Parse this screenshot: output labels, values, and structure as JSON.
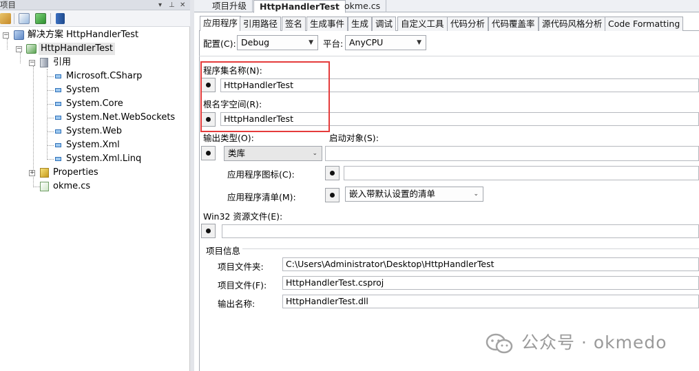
{
  "explorer": {
    "title": "项目",
    "title_controls": [
      "▾",
      "⊥",
      "✕"
    ],
    "tree": {
      "solution": "解决方案 HttpHandlerTest",
      "project": "HttpHandlerTest",
      "references_label": "引用",
      "references": [
        "Microsoft.CSharp",
        "System",
        "System.Core",
        "System.Net.WebSockets",
        "System.Web",
        "System.Xml",
        "System.Xml.Linq"
      ],
      "properties": "Properties",
      "file": "okme.cs"
    }
  },
  "doc_tabs": [
    "项目升级",
    "HttpHandlerTest",
    "okme.cs"
  ],
  "prop_tabs": [
    "应用程序",
    "引用路径",
    "签名",
    "生成事件",
    "生成",
    "调试",
    "自定义工具",
    "代码分析",
    "代码覆盖率",
    "源代码风格分析",
    "Code Formatting"
  ],
  "config": {
    "config_label": "配置(C):",
    "config_value": "Debug",
    "platform_label": "平台:",
    "platform_value": "AnyCPU"
  },
  "form": {
    "assembly_label": "程序集名称(N):",
    "assembly_value": "HttpHandlerTest",
    "namespace_label": "根名字空间(R):",
    "namespace_value": "HttpHandlerTest",
    "output_type_label": "输出类型(O):",
    "output_type_value": "类库",
    "startup_label": "启动对象(S):",
    "icon_label": "应用程序图标(C):",
    "manifest_label": "应用程序清单(M):",
    "manifest_value": "嵌入带默认设置的清单",
    "win32_label": "Win32 资源文件(E):"
  },
  "project_info": {
    "heading": "项目信息",
    "folder_label": "项目文件夹:",
    "folder_value": "C:\\Users\\Administrator\\Desktop\\HttpHandlerTest",
    "file_label": "项目文件(F):",
    "file_value": "HttpHandlerTest.csproj",
    "output_label": "输出名称:",
    "output_value": "HttpHandlerTest.dll"
  },
  "watermark": "公众号 · okmedo",
  "colors": {
    "highlight": "#e53b3b",
    "tab_border": "#a7abb3"
  }
}
